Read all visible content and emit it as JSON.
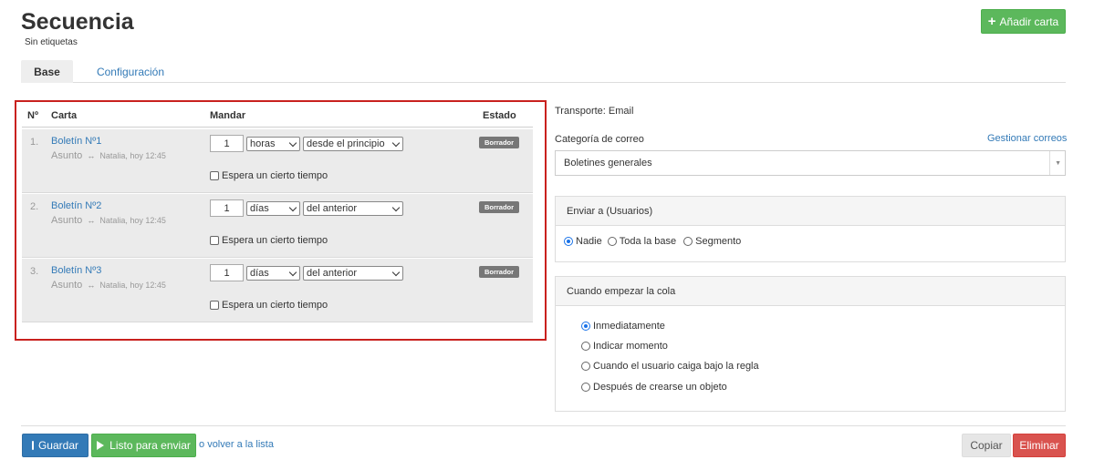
{
  "header": {
    "title": "Secuencia",
    "subtitle": "Sin etiquetas",
    "add_card_label": "Añadir carta"
  },
  "tabs": [
    {
      "label": "Base",
      "active": true
    },
    {
      "label": "Configuración",
      "active": false
    }
  ],
  "sequence_table": {
    "columns": {
      "num": "Nº",
      "card": "Carta",
      "send": "Mandar",
      "status": "Estado"
    },
    "rows": [
      {
        "num": "1.",
        "title": "Boletín Nº1",
        "subject": "Asunto",
        "meta": "Natalia, hoy 12:45",
        "amount": "1",
        "unit": "horas",
        "from": "desde el principio",
        "wait_label": "Espera un cierto tiempo",
        "status": "Borrador"
      },
      {
        "num": "2.",
        "title": "Boletín Nº2",
        "subject": "Asunto",
        "meta": "Natalia, hoy 12:45",
        "amount": "1",
        "unit": "días",
        "from": "del anterior",
        "wait_label": "Espera un cierto tiempo",
        "status": "Borrador"
      },
      {
        "num": "3.",
        "title": "Boletín Nº3",
        "subject": "Asunto",
        "meta": "Natalia, hoy 12:45",
        "amount": "1",
        "unit": "días",
        "from": "del anterior",
        "wait_label": "Espera un cierto tiempo",
        "status": "Borrador"
      }
    ]
  },
  "settings": {
    "transport": "Transporte: Email",
    "category_label": "Categoría de correo",
    "manage_link": "Gestionar correos",
    "category_value": "Boletines generales",
    "send_to": {
      "title": "Enviar a (Usuarios)",
      "options": [
        {
          "label": "Nadie",
          "checked": true
        },
        {
          "label": "Toda la base",
          "checked": false
        },
        {
          "label": "Segmento",
          "checked": false
        }
      ]
    },
    "queue_start": {
      "title": "Cuando empezar la cola",
      "options": [
        {
          "label": "Inmediatamente",
          "checked": true
        },
        {
          "label": "Indicar momento",
          "checked": false
        },
        {
          "label": "Cuando el usuario caiga bajo la regla",
          "checked": false
        },
        {
          "label": "Después de crearse un objeto",
          "checked": false
        }
      ]
    }
  },
  "footer": {
    "save_label": "Guardar",
    "ready_label": "Listo para enviar",
    "back_prefix": "o",
    "back_link": "volver a la lista",
    "copy_label": "Copiar",
    "delete_label": "Eliminar"
  },
  "icons": {
    "add": "plus-icon",
    "save": "floppy-disk-icon",
    "ready": "play-icon",
    "subject_preview": "eye-icon",
    "select": "chevron-down-icon"
  },
  "colors": {
    "link": "#337ab7",
    "success": "#5cb85c",
    "primary": "#337ab7",
    "danger": "#d9534f",
    "status_badge": "#777777",
    "highlight": "#c9211e"
  }
}
